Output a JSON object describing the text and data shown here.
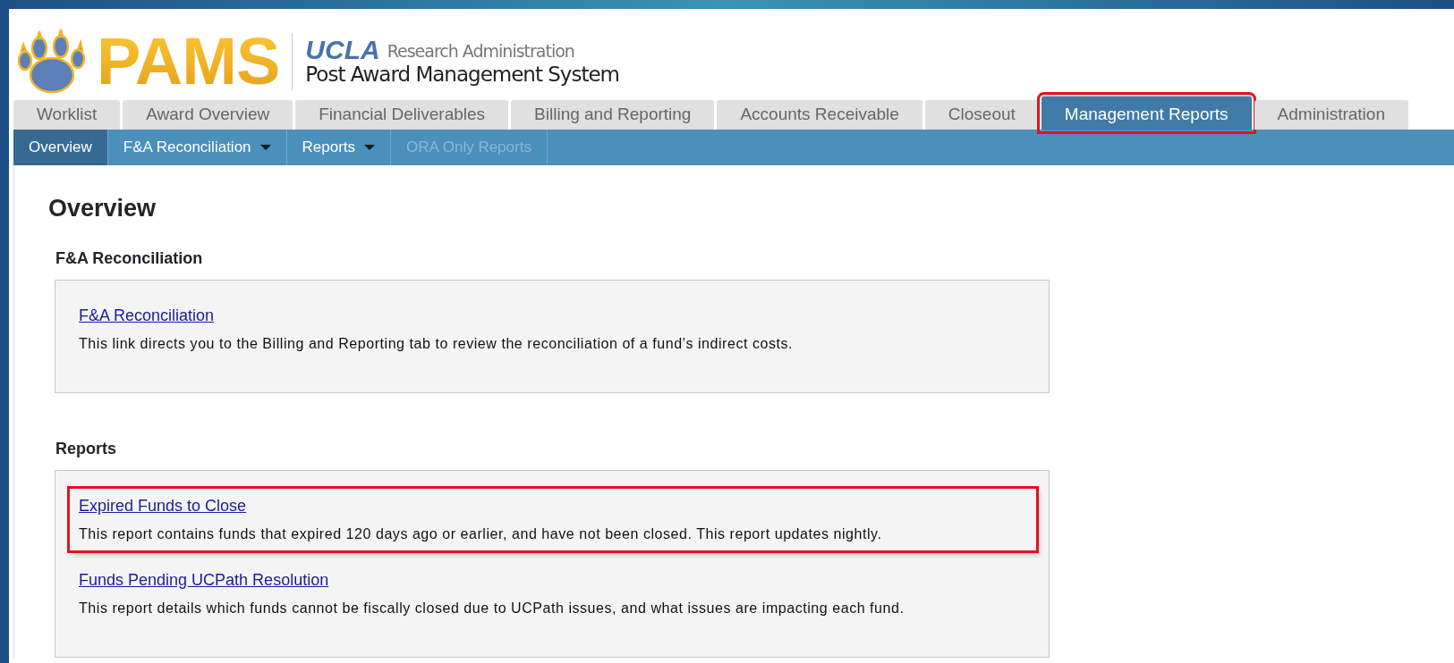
{
  "header": {
    "logo_text": "PAMS",
    "org": "UCLA",
    "org_sub": "Research Administration",
    "system_name": "Post Award Management System"
  },
  "tabs": [
    {
      "label": "Worklist",
      "selected": false,
      "highlighted": false
    },
    {
      "label": "Award Overview",
      "selected": false,
      "highlighted": false
    },
    {
      "label": "Financial Deliverables",
      "selected": false,
      "highlighted": false
    },
    {
      "label": "Billing and Reporting",
      "selected": false,
      "highlighted": false
    },
    {
      "label": "Accounts Receivable",
      "selected": false,
      "highlighted": false
    },
    {
      "label": "Closeout",
      "selected": false,
      "highlighted": false
    },
    {
      "label": "Management Reports",
      "selected": true,
      "highlighted": true
    },
    {
      "label": "Administration",
      "selected": false,
      "highlighted": false
    }
  ],
  "subtabs": [
    {
      "label": "Overview",
      "selected": true,
      "disabled": false,
      "has_menu": false
    },
    {
      "label": "F&A Reconciliation",
      "selected": false,
      "disabled": false,
      "has_menu": true
    },
    {
      "label": "Reports",
      "selected": false,
      "disabled": false,
      "has_menu": true
    },
    {
      "label": "ORA Only Reports",
      "selected": false,
      "disabled": true,
      "has_menu": false
    }
  ],
  "page_title": "Overview",
  "sections": [
    {
      "heading": "F&A Reconciliation",
      "items": [
        {
          "link": "F&A Reconciliation",
          "description": "This link directs you to the Billing and Reporting tab to review the reconciliation of a fund’s indirect costs.",
          "highlighted": false
        }
      ]
    },
    {
      "heading": "Reports",
      "items": [
        {
          "link": "Expired Funds to Close",
          "description": "This report contains funds that expired 120 days ago or earlier, and have not been closed. This report updates nightly.",
          "highlighted": true
        },
        {
          "link": "Funds Pending UCPath Resolution",
          "description": "This report details which funds cannot be fiscally closed due to UCPath issues, and what issues are impacting each fund.",
          "highlighted": false
        }
      ]
    }
  ]
}
